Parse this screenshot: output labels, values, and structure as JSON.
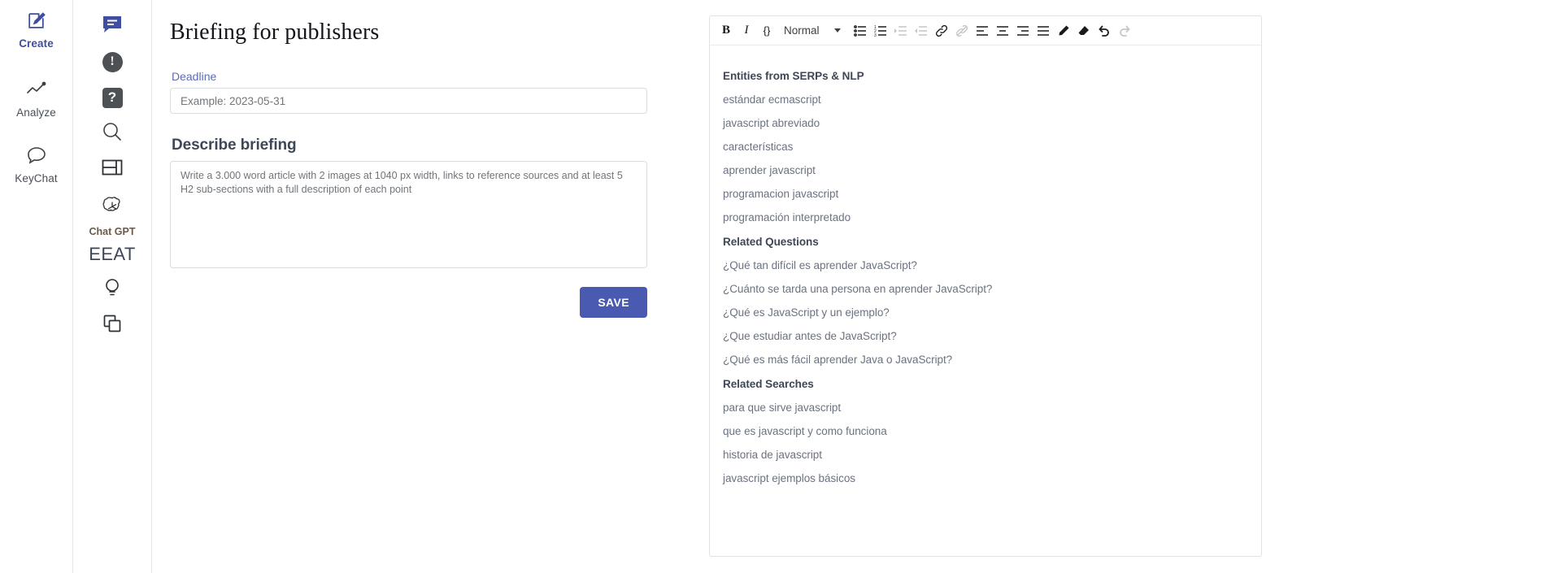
{
  "nav": {
    "items": [
      {
        "label": "Create",
        "icon": "pencil-square-icon"
      },
      {
        "label": "Analyze",
        "icon": "line-chart-icon"
      },
      {
        "label": "KeyChat",
        "icon": "chat-bubble-icon"
      }
    ]
  },
  "rail": {
    "items": [
      {
        "icon": "comment-lines-icon",
        "label": ""
      },
      {
        "icon": "exclamation-circle-icon",
        "label": "",
        "glyph": "!"
      },
      {
        "icon": "question-square-icon",
        "label": "",
        "glyph": "?"
      },
      {
        "icon": "search-icon",
        "label": ""
      },
      {
        "icon": "layout-panel-icon",
        "label": ""
      },
      {
        "icon": "openai-logo-icon",
        "label": "Chat GPT"
      }
    ],
    "eeat_label": "EEAT",
    "bottom_items": [
      {
        "icon": "lightbulb-icon"
      },
      {
        "icon": "copy-icon"
      }
    ]
  },
  "briefing": {
    "title": "Briefing for publishers",
    "deadline_label": "Deadline",
    "deadline_value": "",
    "deadline_placeholder": "Example: 2023-05-31",
    "describe_label": "Describe briefing",
    "describe_value": "",
    "describe_placeholder": "Write a 3.000 word article with 2 images at 1040 px width, links to reference sources and at least 5 H2 sub-sections with a full description of each point",
    "save_label": "SAVE"
  },
  "editor": {
    "toolbar": {
      "bold": "B",
      "italic": "I",
      "code": "{}",
      "format_select": "Normal",
      "buttons": [
        {
          "name": "bullet-list-icon",
          "disabled": false
        },
        {
          "name": "numbered-list-icon",
          "disabled": false
        },
        {
          "name": "indent-increase-icon",
          "disabled": true
        },
        {
          "name": "indent-decrease-icon",
          "disabled": true
        },
        {
          "name": "link-icon",
          "disabled": false
        },
        {
          "name": "unlink-icon",
          "disabled": true
        },
        {
          "name": "align-left-icon",
          "disabled": false
        },
        {
          "name": "align-center-icon",
          "disabled": false
        },
        {
          "name": "align-right-icon",
          "disabled": false
        },
        {
          "name": "align-justify-icon",
          "disabled": false
        },
        {
          "name": "highlighter-icon",
          "disabled": false
        },
        {
          "name": "eraser-icon",
          "disabled": false
        },
        {
          "name": "undo-icon",
          "disabled": false
        },
        {
          "name": "redo-icon",
          "disabled": true
        }
      ]
    },
    "content": [
      {
        "type": "heading",
        "text": "Entities from SERPs & NLP"
      },
      {
        "type": "para",
        "text": "estándar ecmascript"
      },
      {
        "type": "para",
        "text": "javascript abreviado"
      },
      {
        "type": "para",
        "text": "características"
      },
      {
        "type": "para",
        "text": "aprender javascript"
      },
      {
        "type": "para",
        "text": "programacion javascript"
      },
      {
        "type": "para",
        "text": "programación interpretado"
      },
      {
        "type": "heading",
        "text": "Related Questions"
      },
      {
        "type": "para",
        "text": "¿Qué tan difícil es aprender JavaScript?"
      },
      {
        "type": "para",
        "text": "¿Cuánto se tarda una persona en aprender JavaScript?"
      },
      {
        "type": "para",
        "text": "¿Qué es JavaScript y un ejemplo?"
      },
      {
        "type": "para",
        "text": "¿Que estudiar antes de JavaScript?"
      },
      {
        "type": "para",
        "text": "¿Qué es más fácil aprender Java o JavaScript?"
      },
      {
        "type": "heading",
        "text": "Related Searches"
      },
      {
        "type": "para",
        "text": "para que sirve javascript"
      },
      {
        "type": "para",
        "text": "que es javascript y como funciona"
      },
      {
        "type": "para",
        "text": "historia de javascript"
      },
      {
        "type": "para",
        "text": "javascript ejemplos básicos"
      }
    ]
  },
  "colors": {
    "brand": "#4a5ab0",
    "accent_link": "#5b6bb5",
    "text_dark": "#3e4757",
    "text_muted": "#6b7280"
  }
}
